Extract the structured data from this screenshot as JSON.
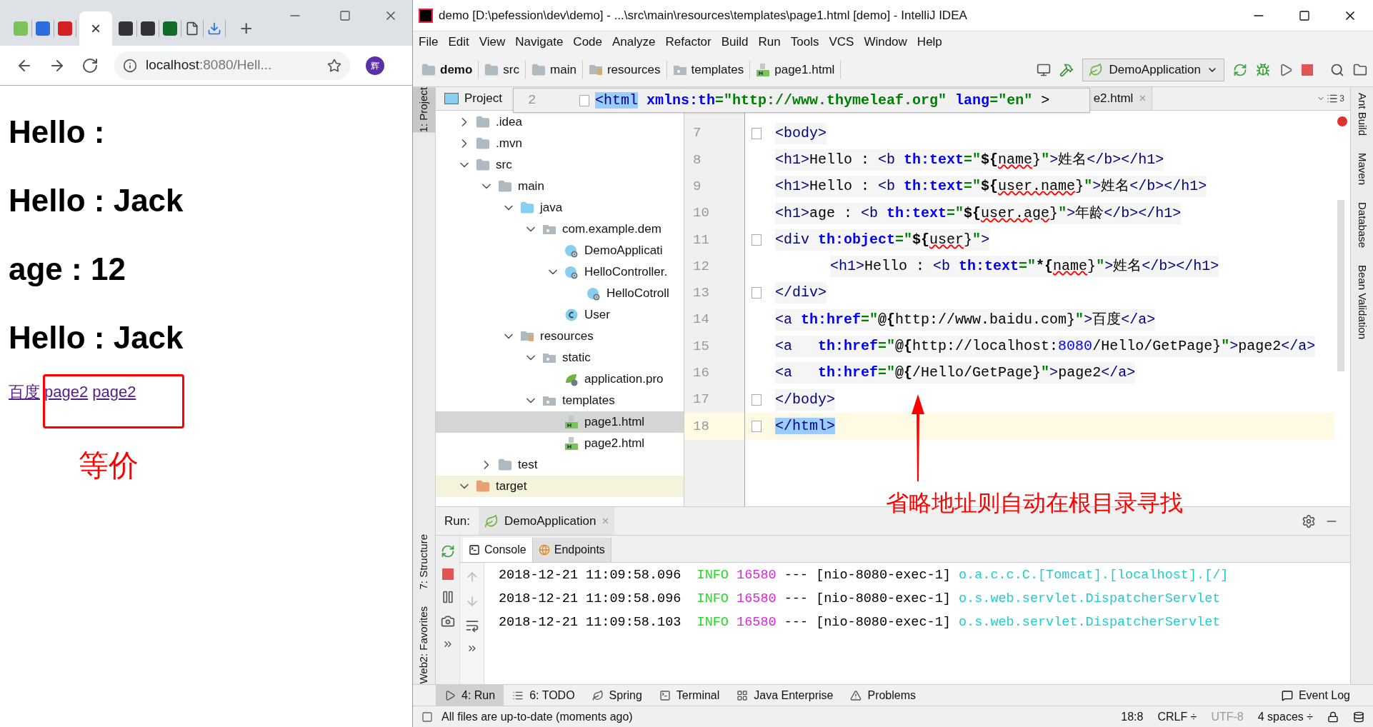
{
  "browser": {
    "active_tab_close": "×",
    "new_tab": "+",
    "address": {
      "host": "localhost",
      "rest": ":8080/Hell..."
    },
    "avatar": "辉",
    "page": {
      "headings": [
        "Hello :",
        "Hello : Jack",
        "age : 12",
        "Hello : Jack"
      ],
      "links": [
        "百度",
        "page2",
        "page2"
      ]
    }
  },
  "ide": {
    "title": "demo [D:\\pefession\\dev\\demo] - ...\\src\\main\\resources\\templates\\page1.html [demo] - IntelliJ IDEA",
    "menu": [
      "File",
      "Edit",
      "View",
      "Navigate",
      "Code",
      "Analyze",
      "Refactor",
      "Build",
      "Run",
      "Tools",
      "VCS",
      "Window",
      "Help"
    ],
    "breadcrumbs": [
      {
        "label": "demo",
        "kind": "project"
      },
      {
        "label": "src",
        "kind": "folder"
      },
      {
        "label": "main",
        "kind": "folder"
      },
      {
        "label": "resources",
        "kind": "resources"
      },
      {
        "label": "templates",
        "kind": "package"
      },
      {
        "label": "page1.html",
        "kind": "html"
      }
    ],
    "run_config": "DemoApplication",
    "left_stripe": [
      {
        "label": "1: Project",
        "selected": true
      },
      {
        "label": "7: Structure",
        "selected": false
      },
      {
        "label": "2: Favorites",
        "selected": false
      },
      {
        "label": "Web",
        "selected": false
      }
    ],
    "right_stripe": [
      "Ant Build",
      "Maven",
      "Database",
      "Bean Validation"
    ],
    "project": {
      "title": "Project",
      "tree": [
        {
          "label": ".idea",
          "kind": "folder",
          "expanded": false,
          "selected": false
        },
        {
          "label": ".mvn",
          "kind": "folder",
          "expanded": false,
          "selected": false
        },
        {
          "label": "src",
          "kind": "folder",
          "expanded": true,
          "selected": false,
          "children": [
            {
              "label": "main",
              "kind": "folder",
              "expanded": true,
              "selected": false,
              "children": [
                {
                  "label": "java",
                  "kind": "source",
                  "expanded": true,
                  "selected": false,
                  "children": [
                    {
                      "label": "com.example.dem",
                      "kind": "package",
                      "expanded": true,
                      "selected": false,
                      "children": [
                        {
                          "label": "DemoApplicati",
                          "kind": "spring-class",
                          "selected": false
                        },
                        {
                          "label": "HelloController.",
                          "kind": "spring-class",
                          "expanded": true,
                          "selected": false,
                          "children": [
                            {
                              "label": "HelloCotroll",
                              "kind": "spring-class",
                              "selected": false
                            }
                          ]
                        },
                        {
                          "label": "User",
                          "kind": "class",
                          "selected": false
                        }
                      ]
                    }
                  ]
                },
                {
                  "label": "resources",
                  "kind": "resources",
                  "expanded": true,
                  "selected": false,
                  "children": [
                    {
                      "label": "static",
                      "kind": "package",
                      "expanded": true,
                      "selected": false,
                      "children": [
                        {
                          "label": "application.pro",
                          "kind": "spring-config",
                          "selected": false
                        }
                      ]
                    },
                    {
                      "label": "templates",
                      "kind": "package",
                      "expanded": true,
                      "selected": false,
                      "children": [
                        {
                          "label": "page1.html",
                          "kind": "html",
                          "selected": true
                        },
                        {
                          "label": "page2.html",
                          "kind": "html",
                          "selected": false
                        }
                      ]
                    }
                  ]
                }
              ]
            },
            {
              "label": "test",
              "kind": "folder",
              "expanded": false,
              "selected": false
            }
          ]
        },
        {
          "label": "target",
          "kind": "excluded",
          "expanded": true,
          "selected": false
        }
      ]
    },
    "editor_tab": {
      "label": "e2.html",
      "close": "×"
    },
    "tab_count": "3",
    "popup": {
      "line": "2",
      "tokens": [
        {
          "kind": "match",
          "text": "<html"
        },
        {
          "kind": "attr",
          "text": " xmlns:th"
        },
        {
          "kind": "quote",
          "text": "=\"http://www.thymeleaf.org\" "
        },
        {
          "kind": "attr",
          "text": "lang"
        },
        {
          "kind": "quote",
          "text": "=\"en\""
        },
        {
          "kind": "text",
          "text": " >"
        }
      ]
    },
    "code": [
      {
        "number": "7",
        "fold": true,
        "current": false,
        "indented": false,
        "tokens": [
          {
            "kind": "tag",
            "text": "<body>"
          }
        ]
      },
      {
        "number": "8",
        "fold": false,
        "current": false,
        "indented": false,
        "tokens": [
          {
            "kind": "tag",
            "text": "<h1>"
          },
          {
            "kind": "text",
            "text": "Hello : "
          },
          {
            "kind": "tag",
            "text": "<b "
          },
          {
            "kind": "attr",
            "text": "th:text"
          },
          {
            "kind": "quote",
            "text": "=\""
          },
          {
            "kind": "expr",
            "text": "${"
          },
          {
            "kind": "var",
            "text": "name"
          },
          {
            "kind": "text",
            "text": "}"
          },
          {
            "kind": "quote",
            "text": "\""
          },
          {
            "kind": "tag",
            "text": ">"
          },
          {
            "kind": "text",
            "text": "姓名"
          },
          {
            "kind": "tag",
            "text": "</b></h1>"
          }
        ]
      },
      {
        "number": "9",
        "fold": false,
        "current": false,
        "indented": false,
        "tokens": [
          {
            "kind": "tag",
            "text": "<h1>"
          },
          {
            "kind": "text",
            "text": "Hello : "
          },
          {
            "kind": "tag",
            "text": "<b "
          },
          {
            "kind": "attr",
            "text": "th:text"
          },
          {
            "kind": "quote",
            "text": "=\""
          },
          {
            "kind": "expr",
            "text": "${"
          },
          {
            "kind": "var",
            "text": "user.name"
          },
          {
            "kind": "text",
            "text": "}"
          },
          {
            "kind": "quote",
            "text": "\""
          },
          {
            "kind": "tag",
            "text": ">"
          },
          {
            "kind": "text",
            "text": "姓名"
          },
          {
            "kind": "tag",
            "text": "</b></h1>"
          }
        ]
      },
      {
        "number": "10",
        "fold": false,
        "current": false,
        "indented": false,
        "tokens": [
          {
            "kind": "tag",
            "text": "<h1>"
          },
          {
            "kind": "text",
            "text": "age : "
          },
          {
            "kind": "tag",
            "text": "<b "
          },
          {
            "kind": "attr",
            "text": "th:text"
          },
          {
            "kind": "quote",
            "text": "=\""
          },
          {
            "kind": "expr",
            "text": "${"
          },
          {
            "kind": "var",
            "text": "user.age"
          },
          {
            "kind": "text",
            "text": "}"
          },
          {
            "kind": "quote",
            "text": "\""
          },
          {
            "kind": "tag",
            "text": ">"
          },
          {
            "kind": "text",
            "text": "年龄"
          },
          {
            "kind": "tag",
            "text": "</b></h1>"
          }
        ]
      },
      {
        "number": "11",
        "fold": true,
        "current": false,
        "indented": false,
        "tokens": [
          {
            "kind": "tag",
            "text": "<div "
          },
          {
            "kind": "attr",
            "text": "th:object"
          },
          {
            "kind": "quote",
            "text": "=\""
          },
          {
            "kind": "expr",
            "text": "${"
          },
          {
            "kind": "var",
            "text": "user"
          },
          {
            "kind": "text",
            "text": "}"
          },
          {
            "kind": "quote",
            "text": "\""
          },
          {
            "kind": "tag",
            "text": ">"
          }
        ]
      },
      {
        "number": "12",
        "fold": false,
        "current": false,
        "indented": true,
        "tokens": [
          {
            "kind": "tag",
            "text": "<h1>"
          },
          {
            "kind": "text",
            "text": "Hello : "
          },
          {
            "kind": "tag",
            "text": "<b "
          },
          {
            "kind": "attr",
            "text": "th:text"
          },
          {
            "kind": "quote",
            "text": "=\""
          },
          {
            "kind": "expr",
            "text": "*{"
          },
          {
            "kind": "var",
            "text": "name"
          },
          {
            "kind": "text",
            "text": "}"
          },
          {
            "kind": "quote",
            "text": "\""
          },
          {
            "kind": "tag",
            "text": ">"
          },
          {
            "kind": "text",
            "text": "姓名"
          },
          {
            "kind": "tag",
            "text": "</b></h1>"
          }
        ]
      },
      {
        "number": "13",
        "fold": true,
        "current": false,
        "indented": false,
        "tokens": [
          {
            "kind": "tag",
            "text": "</div>"
          }
        ]
      },
      {
        "number": "14",
        "fold": false,
        "current": false,
        "indented": false,
        "tokens": [
          {
            "kind": "tag",
            "text": "<a "
          },
          {
            "kind": "attr",
            "text": "th:href"
          },
          {
            "kind": "quote",
            "text": "=\""
          },
          {
            "kind": "expr",
            "text": "@{"
          },
          {
            "kind": "text",
            "text": "http://www.baidu.com}"
          },
          {
            "kind": "quote",
            "text": "\""
          },
          {
            "kind": "tag",
            "text": ">"
          },
          {
            "kind": "text",
            "text": "百度"
          },
          {
            "kind": "tag",
            "text": "</a>"
          }
        ]
      },
      {
        "number": "15",
        "fold": false,
        "current": false,
        "indented": false,
        "tokens": [
          {
            "kind": "tag",
            "text": "<a   "
          },
          {
            "kind": "attr",
            "text": "th:href"
          },
          {
            "kind": "quote",
            "text": "=\""
          },
          {
            "kind": "expr",
            "text": "@{"
          },
          {
            "kind": "text",
            "text": "http://localhost:"
          },
          {
            "kind": "num",
            "text": "8080"
          },
          {
            "kind": "text",
            "text": "/Hello/GetPage}"
          },
          {
            "kind": "quote",
            "text": "\""
          },
          {
            "kind": "tag",
            "text": ">"
          },
          {
            "kind": "text",
            "text": "page2"
          },
          {
            "kind": "tag",
            "text": "</a>"
          }
        ]
      },
      {
        "number": "16",
        "fold": false,
        "current": false,
        "indented": false,
        "tokens": [
          {
            "kind": "tag",
            "text": "<a   "
          },
          {
            "kind": "attr",
            "text": "th:href"
          },
          {
            "kind": "quote",
            "text": "=\""
          },
          {
            "kind": "expr",
            "text": "@{"
          },
          {
            "kind": "text",
            "text": "/Hello/GetPage}"
          },
          {
            "kind": "quote",
            "text": "\""
          },
          {
            "kind": "tag",
            "text": ">"
          },
          {
            "kind": "text",
            "text": "page2"
          },
          {
            "kind": "tag",
            "text": "</a>"
          }
        ]
      },
      {
        "number": "17",
        "fold": true,
        "current": false,
        "indented": false,
        "tokens": [
          {
            "kind": "tag",
            "text": "</body>"
          }
        ]
      },
      {
        "number": "18",
        "fold": true,
        "current": true,
        "indented": false,
        "tokens": [
          {
            "kind": "match",
            "text": "</html>"
          }
        ]
      }
    ],
    "run": {
      "label": "Run:",
      "tab": "DemoApplication",
      "close": "×",
      "tabs": [
        {
          "label": "Console",
          "selected": true
        },
        {
          "label": "Endpoints",
          "selected": false
        }
      ],
      "log": [
        {
          "time": "2018-12-21 11:09:58.096",
          "level": "INFO",
          "pid": "16580",
          "sep": "---",
          "thread": "[nio-8080-exec-1]",
          "logger": "o.a.c.c.C.[Tomcat].[localhost].[/]"
        },
        {
          "time": "2018-12-21 11:09:58.096",
          "level": "INFO",
          "pid": "16580",
          "sep": "---",
          "thread": "[nio-8080-exec-1]",
          "logger": "o.s.web.servlet.DispatcherServlet"
        },
        {
          "time": "2018-12-21 11:09:58.103",
          "level": "INFO",
          "pid": "16580",
          "sep": "---",
          "thread": "[nio-8080-exec-1]",
          "logger": "o.s.web.servlet.DispatcherServlet"
        }
      ]
    },
    "tool_tabs": [
      {
        "label": "4: Run",
        "kind": "run",
        "selected": true
      },
      {
        "label": "6: TODO",
        "kind": "todo",
        "selected": false
      },
      {
        "label": "Spring",
        "kind": "spring",
        "selected": false
      },
      {
        "label": "Terminal",
        "kind": "terminal",
        "selected": false
      },
      {
        "label": "Java Enterprise",
        "kind": "enterprise",
        "selected": false
      },
      {
        "label": "Problems",
        "kind": "problems",
        "selected": false
      }
    ],
    "event_log": "Event Log",
    "status": {
      "message": "All files are up-to-date (moments ago)",
      "position": "18:8",
      "line_sep": "CRLF ÷",
      "encoding": "UTF-8",
      "indent": "4 spaces ÷"
    }
  },
  "annotations": [
    {
      "kind": "box"
    },
    {
      "kind": "label",
      "text": "等价"
    },
    {
      "kind": "arrow"
    },
    {
      "kind": "label",
      "text": "省略地址则自动在根目录寻找"
    }
  ]
}
